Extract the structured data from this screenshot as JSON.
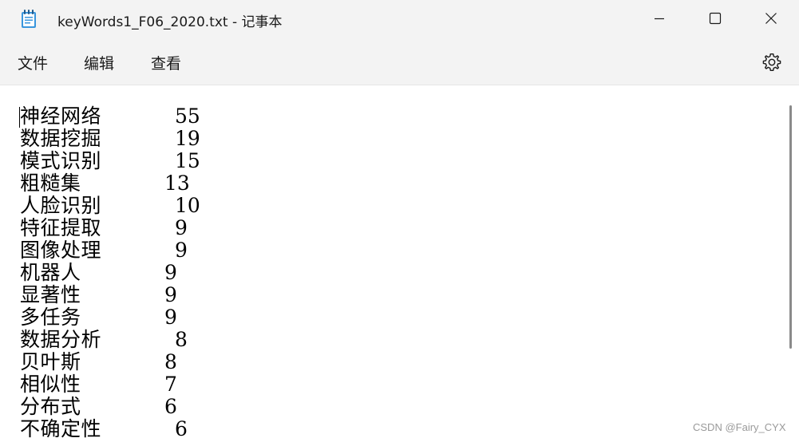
{
  "window": {
    "title": "keyWords1_F06_2020.txt - 记事本",
    "app_icon": "notepad-icon"
  },
  "controls": {
    "minimize_icon": "minimize-icon",
    "maximize_icon": "maximize-icon",
    "close_icon": "close-icon"
  },
  "menu": {
    "file": "文件",
    "edit": "编辑",
    "view": "查看",
    "settings_icon": "gear-icon"
  },
  "document": {
    "lines": [
      {
        "word": "神经网络",
        "count": "55"
      },
      {
        "word": "数据挖掘",
        "count": "19"
      },
      {
        "word": "模式识别",
        "count": "15"
      },
      {
        "word": "粗糙集",
        "count": "13"
      },
      {
        "word": "人脸识别",
        "count": "10"
      },
      {
        "word": "特征提取",
        "count": "9"
      },
      {
        "word": "图像处理",
        "count": "9"
      },
      {
        "word": "机器人",
        "count": "9"
      },
      {
        "word": "显著性",
        "count": "9"
      },
      {
        "word": "多任务",
        "count": "9"
      },
      {
        "word": "数据分析",
        "count": "8"
      },
      {
        "word": "贝叶斯",
        "count": "8"
      },
      {
        "word": "相似性",
        "count": "7"
      },
      {
        "word": "分布式",
        "count": "6"
      },
      {
        "word": "不确定性",
        "count": "6"
      }
    ]
  },
  "watermark": "CSDN @Fairy_CYX",
  "colors": {
    "chrome_background": "#f3f3f3",
    "editor_background": "#ffffff",
    "text": "#000000",
    "watermark": "#9a9a9a"
  }
}
